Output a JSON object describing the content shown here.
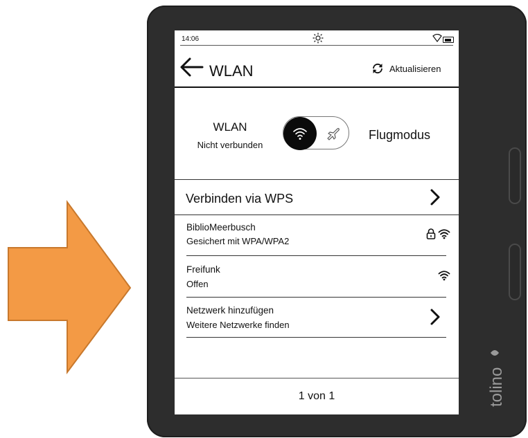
{
  "status_bar": {
    "time": "14:06"
  },
  "header": {
    "title": "WLAN",
    "refresh_label": "Aktualisieren"
  },
  "mode": {
    "wlan_label": "WLAN",
    "wlan_status": "Nicht verbunden",
    "flight_label": "Flugmodus"
  },
  "wps": {
    "label": "Verbinden via WPS"
  },
  "networks": [
    {
      "name": "BiblioMeerbusch",
      "security": "Gesichert mit WPA/WPA2",
      "locked": true
    },
    {
      "name": "Freifunk",
      "security": "Offen",
      "locked": false
    }
  ],
  "add_network": {
    "label": "Netzwerk hinzufügen",
    "sub": "Weitere Netzwerke finden"
  },
  "footer": {
    "page_label": "1 von 1"
  },
  "brand": {
    "logo_text": "tolino"
  },
  "colors": {
    "arrow_fill": "#f39a45",
    "arrow_stroke": "#c8782c",
    "device_body": "#2d2d2d"
  }
}
